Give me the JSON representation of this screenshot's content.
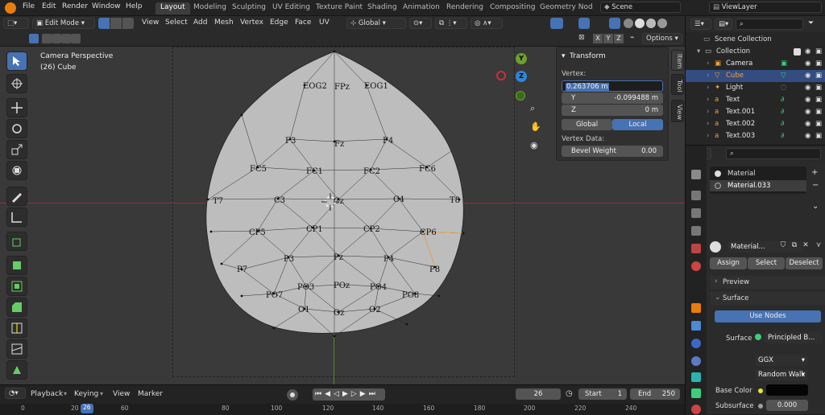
{
  "topbar": {
    "menus": [
      "File",
      "Edit",
      "Render",
      "Window",
      "Help"
    ],
    "workspaces": [
      "Layout",
      "Modeling",
      "Sculpting",
      "UV Editing",
      "Texture Paint",
      "Shading",
      "Animation",
      "Rendering",
      "Compositing",
      "Geometry Nod"
    ],
    "active_workspace": "Layout",
    "scene": "Scene",
    "view_layer": "ViewLayer"
  },
  "header": {
    "mode": "Edit Mode",
    "menus": [
      "View",
      "Select",
      "Add",
      "Mesh",
      "Vertex",
      "Edge",
      "Face",
      "UV"
    ],
    "orientation": "Global",
    "axes": [
      "X",
      "Y",
      "Z"
    ],
    "options_label": "Options"
  },
  "viewport": {
    "view_name": "Camera Perspective",
    "object_name": "(26) Cube",
    "gizmo": {
      "y": "Y",
      "z": "Z"
    },
    "labels": [
      "FPz",
      "EOG2",
      "EOG1",
      "F3",
      "Fz",
      "F4",
      "FC5",
      "FC1",
      "FC2",
      "FC6",
      "T7",
      "C3",
      "Cz",
      "C4",
      "T8",
      "CP5",
      "CP1",
      "CP2",
      "CP6",
      "P7",
      "P3",
      "Pz",
      "P4",
      "P8",
      "PO7",
      "PO3",
      "POz",
      "PO4",
      "PO8",
      "O1",
      "Oz",
      "O2"
    ]
  },
  "npanel": {
    "title": "Transform",
    "vertex_label": "Vertex:",
    "x_value": "0.263706 m",
    "y_label": "Y",
    "y_value": "-0.099488 m",
    "z_label": "Z",
    "z_value": "0 m",
    "global_label": "Global",
    "local_label": "Local",
    "vertex_data_label": "Vertex Data:",
    "bevel_label": "Bevel Weight",
    "bevel_value": "0.00",
    "tabs": [
      "Item",
      "Tool",
      "View"
    ]
  },
  "timeline": {
    "menus": [
      "Playback",
      "Keying",
      "View",
      "Marker"
    ],
    "current_frame": "26",
    "start_label": "Start",
    "start_value": "1",
    "end_label": "End",
    "end_value": "250",
    "ruler": [
      "0",
      "20",
      "26",
      "60",
      "80",
      "100",
      "120",
      "140",
      "160",
      "180",
      "200",
      "220",
      "240"
    ]
  },
  "outliner": {
    "root": "Scene Collection",
    "collection": "Collection",
    "items": [
      {
        "name": "Camera",
        "color": "#e6e6e6"
      },
      {
        "name": "Cube",
        "color": "#f0a040"
      },
      {
        "name": "Light",
        "color": "#e6e6e6"
      },
      {
        "name": "Text",
        "color": "#e6e6e6"
      },
      {
        "name": "Text.001",
        "color": "#e6e6e6"
      },
      {
        "name": "Text.002",
        "color": "#e6e6e6"
      },
      {
        "name": "Text.003",
        "color": "#e6e6e6"
      }
    ]
  },
  "properties": {
    "slots": [
      "Material",
      "Material.033"
    ],
    "material_name": "Material...",
    "assign": "Assign",
    "select": "Select",
    "deselect": "Deselect",
    "preview": "Preview",
    "surface_section": "Surface",
    "use_nodes": "Use Nodes",
    "surface_label": "Surface",
    "surface_value": "Principled B...",
    "distribution": "GGX",
    "subsurface_method": "Random Walk",
    "base_color_label": "Base Color",
    "subsurface_label": "Subsurface",
    "subsurface_value": "0.000"
  },
  "colors": {
    "accent": "#4772b3",
    "active_object": "#f0a040",
    "x_axis": "#c83040",
    "y_axis": "#6aa02c"
  }
}
